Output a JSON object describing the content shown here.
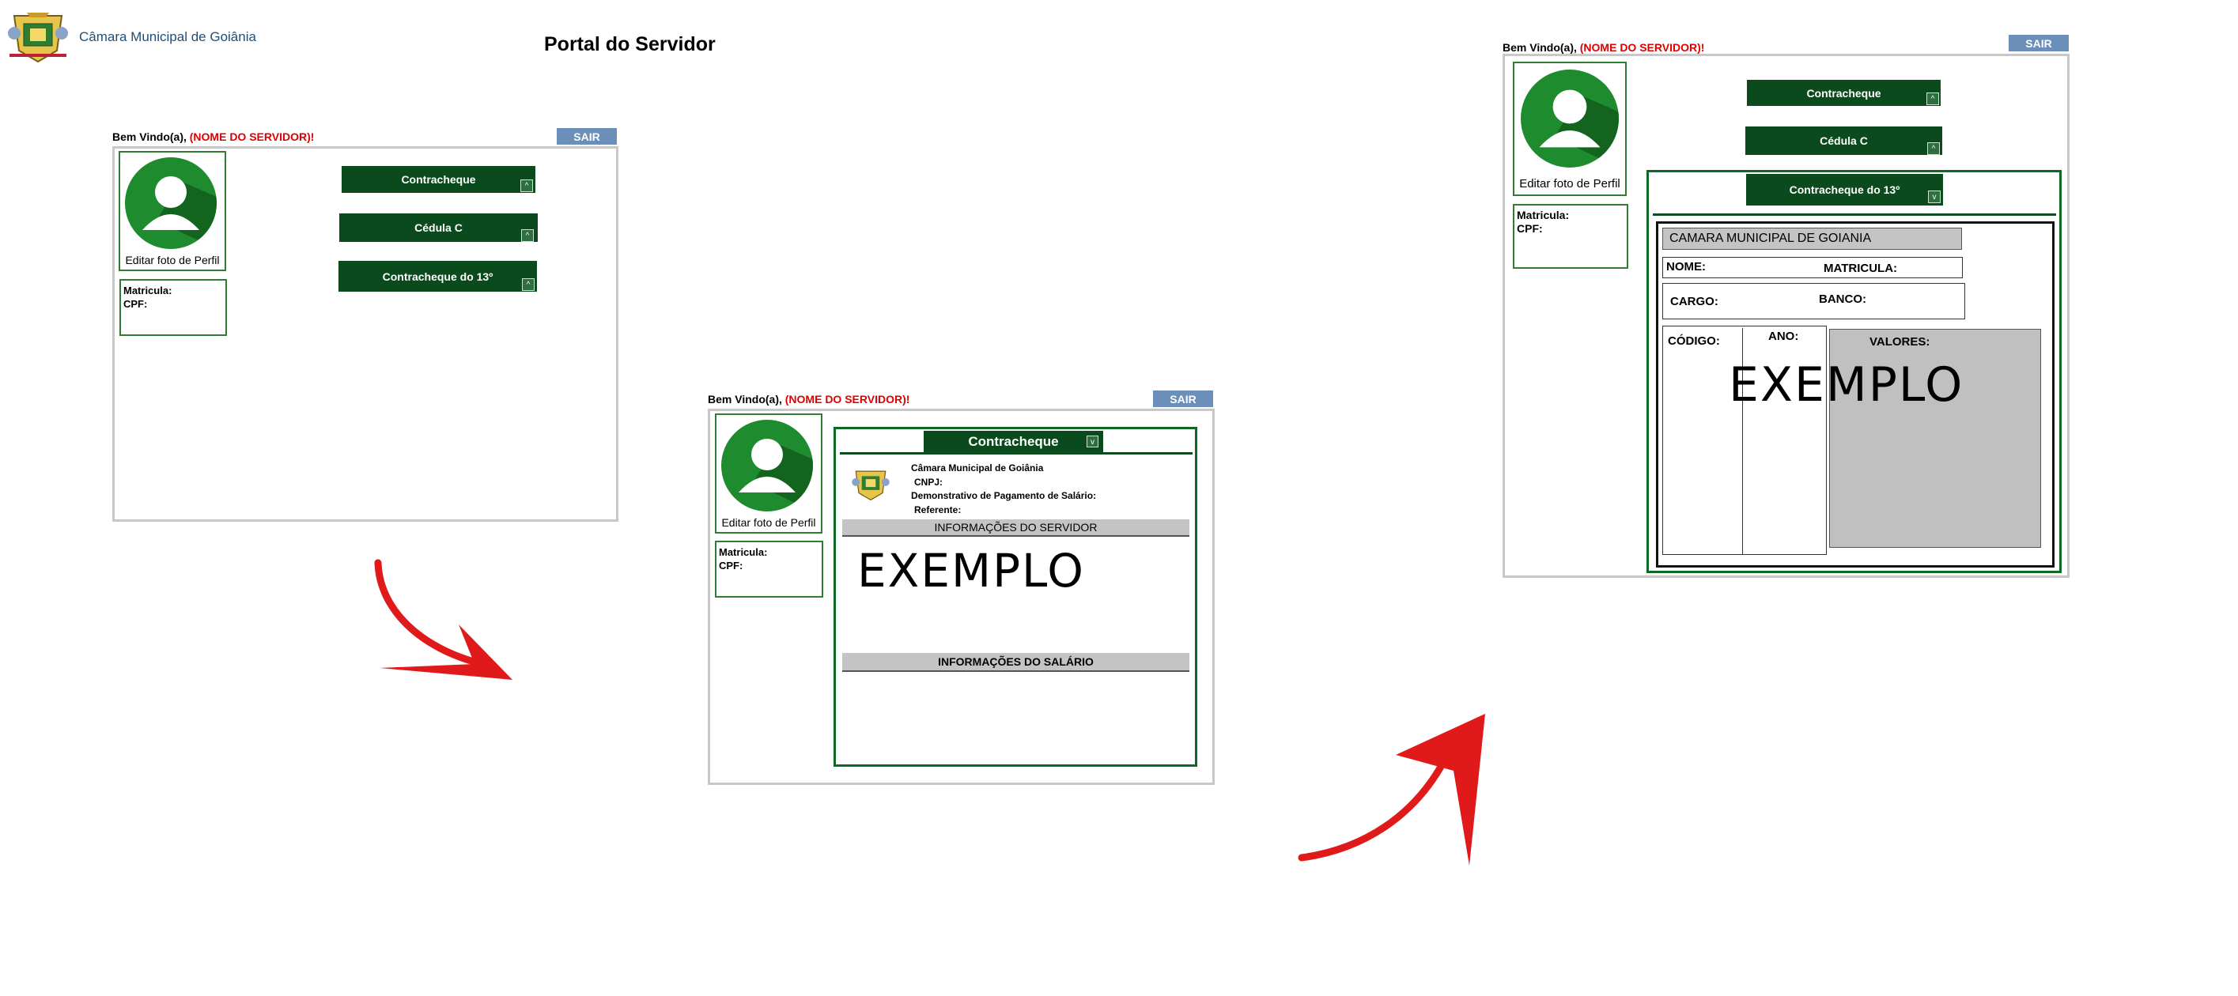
{
  "header": {
    "brand_name": "Câmara Municipal de Goiânia",
    "page_title": "Portal do Servidor"
  },
  "common": {
    "welcome_prefix": "Bem Vindo(a),",
    "welcome_name": "(NOME DO SERVIDOR)!",
    "sair_label": "SAIR",
    "edit_photo_label": "Editar foto de Perfil",
    "matricula_label": "Matricula:",
    "cpf_label": "CPF:",
    "btn_contracheque": "Contracheque",
    "btn_cedula": "Cédula C",
    "btn_decimo": "Contracheque do 13º"
  },
  "payslip": {
    "header_title": "Contracheque",
    "org_name": "Câmara Municipal de Goiânia",
    "cnpj_label": "CNPJ:",
    "demo_label": "Demonstrativo de Pagamento de Salário:",
    "referente_label": "Referente:",
    "info_servidor": "INFORMAÇÕES DO SERVIDOR",
    "info_salario": "INFORMAÇÕES DO SALÁRIO",
    "example_text": "EXEMPLO"
  },
  "decimo": {
    "org_title": "CAMARA MUNICIPAL DE GOIANIA",
    "nome_label": "NOME:",
    "matricula_label": "MATRICULA:",
    "cargo_label": "CARGO:",
    "banco_label": "BANCO:",
    "codigo_label": "CÓDIGO:",
    "ano_label": "ANO:",
    "valores_label": "VALORES:",
    "example_text": "EXEMPLO"
  },
  "colors": {
    "dark_green": "#0a4a1c",
    "avatar_green": "#1e8b2e",
    "sair_blue": "#6b8fb8",
    "name_red": "#e00000",
    "arrow_red": "#e01a1a"
  }
}
